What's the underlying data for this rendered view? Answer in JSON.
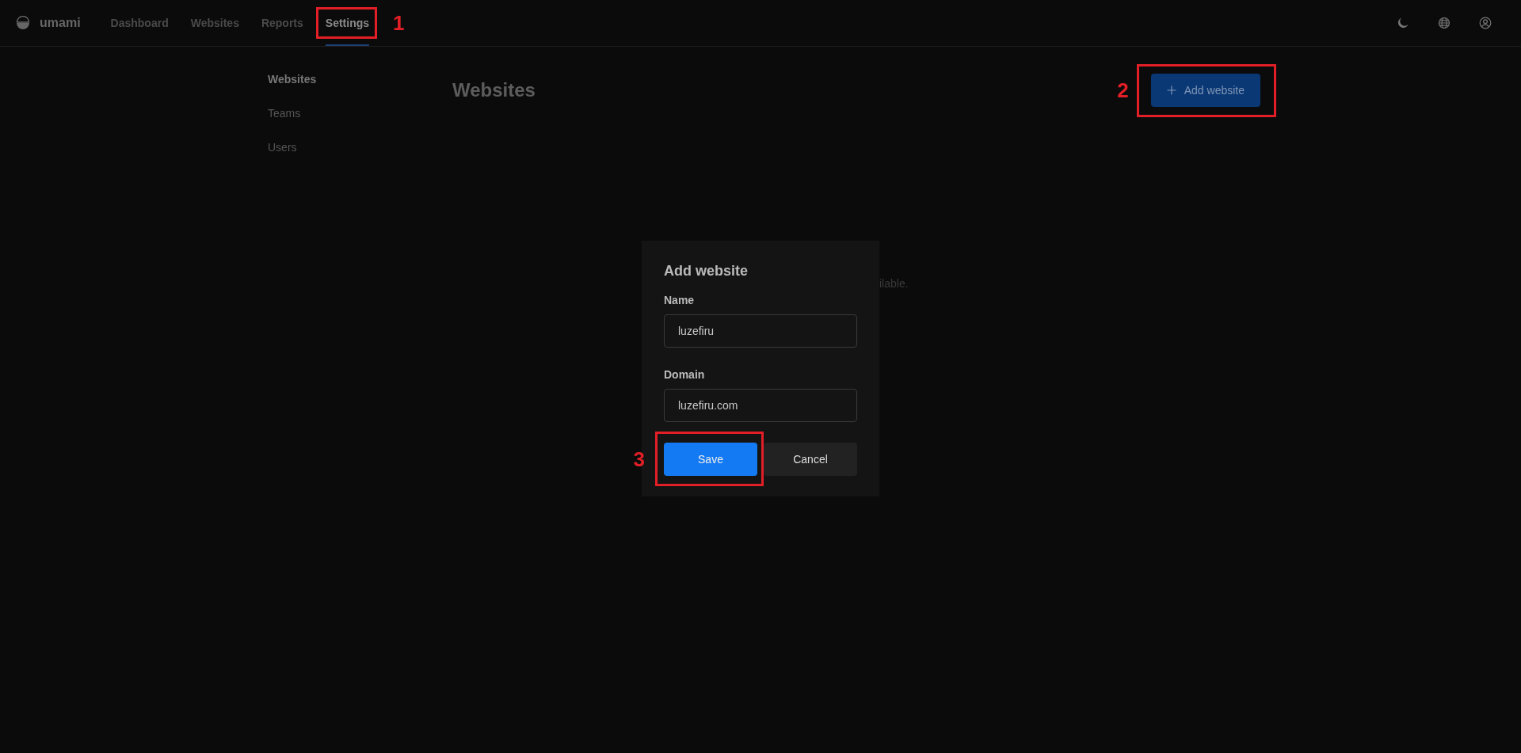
{
  "header": {
    "logo": "umami",
    "nav": [
      {
        "label": "Dashboard",
        "selected": false
      },
      {
        "label": "Websites",
        "selected": false
      },
      {
        "label": "Reports",
        "selected": false
      },
      {
        "label": "Settings",
        "selected": true,
        "callout": "1"
      }
    ]
  },
  "sidebar": {
    "items": [
      {
        "label": "Websites",
        "selected": true
      },
      {
        "label": "Teams",
        "selected": false
      },
      {
        "label": "Users",
        "selected": false
      }
    ]
  },
  "page": {
    "title": "Websites",
    "add_button": {
      "label": "Add website",
      "callout": "2"
    },
    "empty_text": "ilable."
  },
  "dialog": {
    "title": "Add website",
    "fields": [
      {
        "label": "Name",
        "value": "luzefiru"
      },
      {
        "label": "Domain",
        "value": "luzefiru.com"
      }
    ],
    "buttons": [
      {
        "label": "Save",
        "kind": "primary",
        "callout": "3"
      },
      {
        "label": "Cancel",
        "kind": "secondary"
      }
    ]
  }
}
